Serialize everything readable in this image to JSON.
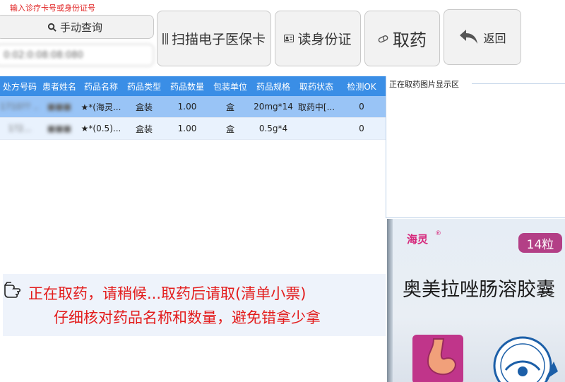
{
  "header": {
    "hint": "输入诊疗卡号或身份证号",
    "manual_label": "手动查询",
    "card_value": "0:02:0:08:08:080",
    "scan_label": "扫描电子医保卡",
    "idcard_label": "读身份证",
    "pick_label": "取药",
    "back_label": "返回"
  },
  "table": {
    "columns": [
      "处方号码",
      "患者姓名",
      "药品名称",
      "药品类型",
      "药品数量",
      "包装单位",
      "药品规格",
      "取药状态",
      "检测OK"
    ],
    "rows": [
      [
        "1710?? ...",
        "■■■",
        "★*(海灵...",
        "盒装",
        "1.00",
        "盒",
        "20mg*14",
        "取药中[...",
        "0"
      ],
      [
        "1?2... ",
        "■■■",
        "★*(0.5)...",
        "盒装",
        "1.00",
        "盒",
        "0.5g*4",
        "",
        "0"
      ]
    ]
  },
  "image_area": {
    "title": "正在取药图片显示区"
  },
  "notice": {
    "line1": "正在取药，请稍候...取药后请取(清单小票)",
    "line2": "仔细核对药品名称和数量，避免错拿少拿"
  },
  "photo": {
    "brand": "海灵",
    "reg": "®",
    "count": "14粒",
    "name": "奥美拉唑肠溶胶囊"
  },
  "colors": {
    "accent": "#3a8ee6",
    "selected_row": "#99c4f6",
    "alert": "#e31c1c"
  }
}
